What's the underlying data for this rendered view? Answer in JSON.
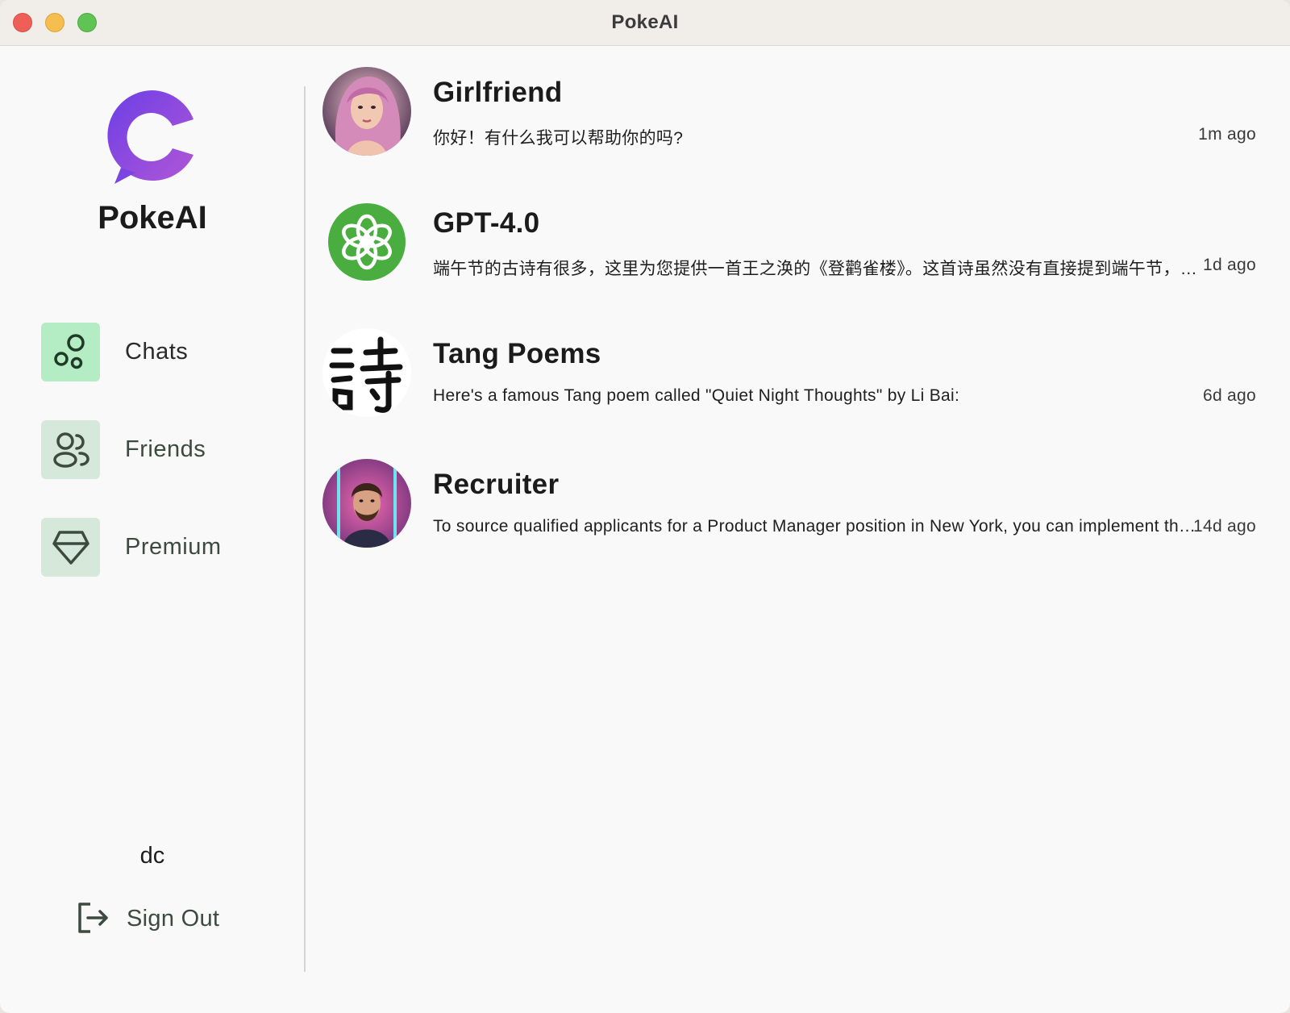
{
  "window": {
    "title": "PokeAI"
  },
  "sidebar": {
    "brand": "PokeAI",
    "nav": [
      {
        "label": "Chats",
        "icon": "bubbles-icon",
        "active": true
      },
      {
        "label": "Friends",
        "icon": "users-icon",
        "active": false
      },
      {
        "label": "Premium",
        "icon": "gem-icon",
        "active": false
      }
    ],
    "user_name": "dc",
    "sign_out_label": "Sign Out"
  },
  "chats": [
    {
      "name": "Girlfriend",
      "preview": "你好！有什么我可以帮助你的吗?",
      "time": "1m ago",
      "avatar": "girlfriend-avatar"
    },
    {
      "name": "GPT-4.0",
      "preview": "端午节的古诗有很多，这里为您提供一首王之涣的《登鹳雀楼》。这首诗虽然没有直接提到端午节，但描绘了端午时节的景色",
      "time": "1d ago",
      "avatar": "openai-logo-avatar"
    },
    {
      "name": "Tang Poems",
      "preview": "Here's a famous Tang poem called \"Quiet Night Thoughts\" by Li Bai:",
      "time": "6d ago",
      "avatar": "poem-character-avatar"
    },
    {
      "name": "Recruiter",
      "preview": "To source qualified applicants for a Product Manager position in New York, you can implement the following strategies",
      "time": "14d ago",
      "avatar": "recruiter-avatar"
    }
  ],
  "colors": {
    "accent_active": "#b4ecc4",
    "nav_icon_bg": "#d6e8da",
    "logo_purple": "#8a4be0",
    "openai_green": "#49ad3f"
  }
}
